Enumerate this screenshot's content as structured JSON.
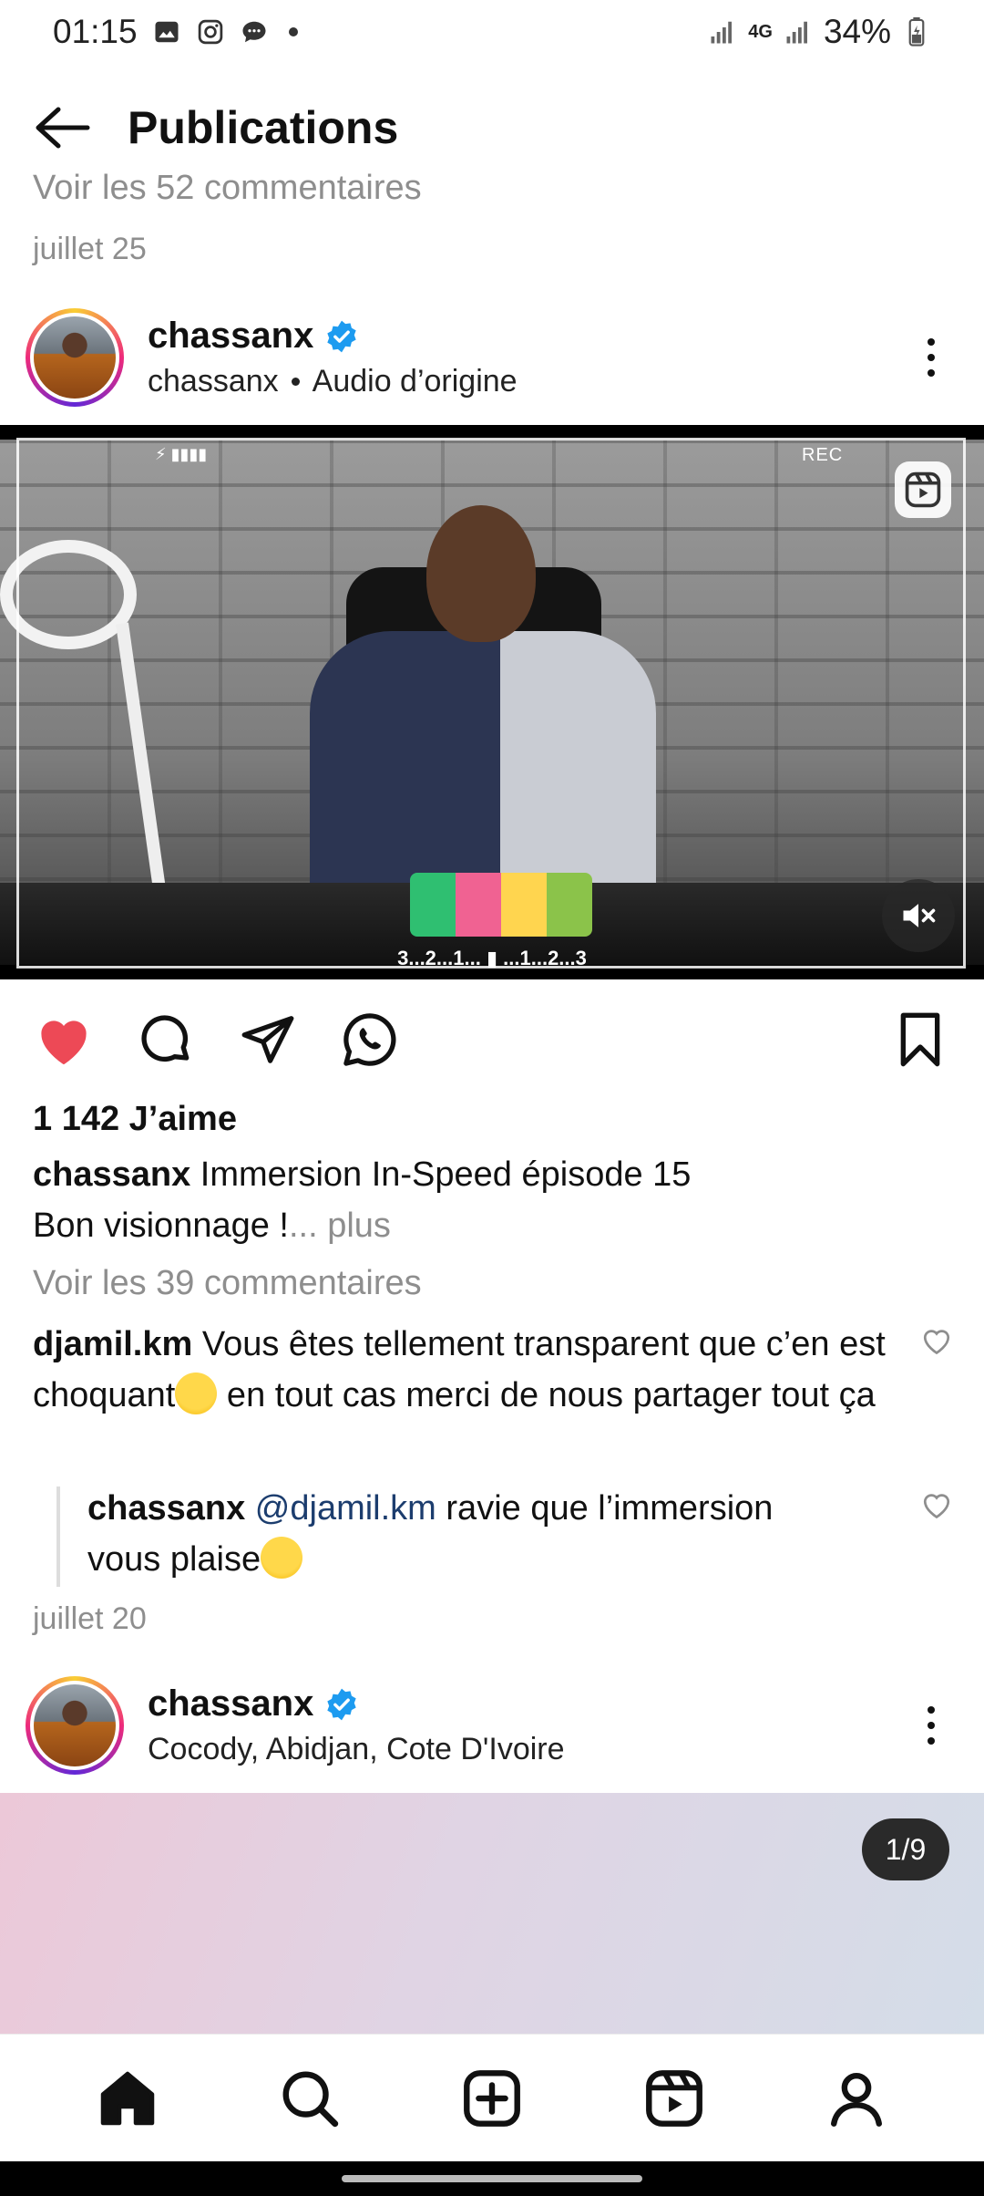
{
  "status_bar": {
    "time": "01:15",
    "battery": "34%",
    "network": "4G"
  },
  "header": {
    "title": "Publications"
  },
  "previous_post": {
    "comments_link": "Voir les 52 commentaires",
    "date": "juillet 25"
  },
  "post": {
    "username": "chassanx",
    "audio_owner": "chassanx",
    "audio_label": "Audio d’origine",
    "video": {
      "rec_label": "REC",
      "countdown": "3...2...1...  ▮  ...1...2...3"
    },
    "likes": "1 142 J’aime",
    "caption_user": "chassanx",
    "caption_text": " Immersion In-Speed  épisode 15",
    "caption_line2": "Bon visionnage !",
    "caption_more": "... plus",
    "view_comments": "Voir les 39 commentaires",
    "comments": [
      {
        "user": "djamil.km",
        "text_before": " Vous êtes tellement transparent que c’en est choquant",
        "text_after": " en tout cas merci de nous partager tout ça"
      },
      {
        "user": "chassanx",
        "mention": "@djamil.km",
        "text_before": " ravie que l’immersion vous plaise"
      }
    ],
    "date": "juillet 20"
  },
  "next_post": {
    "username": "chassanx",
    "location": "Cocody, Abidjan, Cote D'Ivoire",
    "carousel_counter": "1/9"
  },
  "colors": {
    "like_red": "#ed4956",
    "verified_blue": "#1d9bf0",
    "mention_blue": "#1c3d6e",
    "muted": "#8e8e8e"
  },
  "icons": {
    "status": [
      "gallery-icon",
      "instagram-icon",
      "messages-icon",
      "signal-icon",
      "battery-icon"
    ],
    "actions": [
      "heart-filled-icon",
      "comment-icon",
      "share-icon",
      "whatsapp-icon",
      "bookmark-icon"
    ],
    "nav": [
      "home-icon",
      "search-icon",
      "create-icon",
      "reels-icon",
      "profile-icon"
    ]
  }
}
